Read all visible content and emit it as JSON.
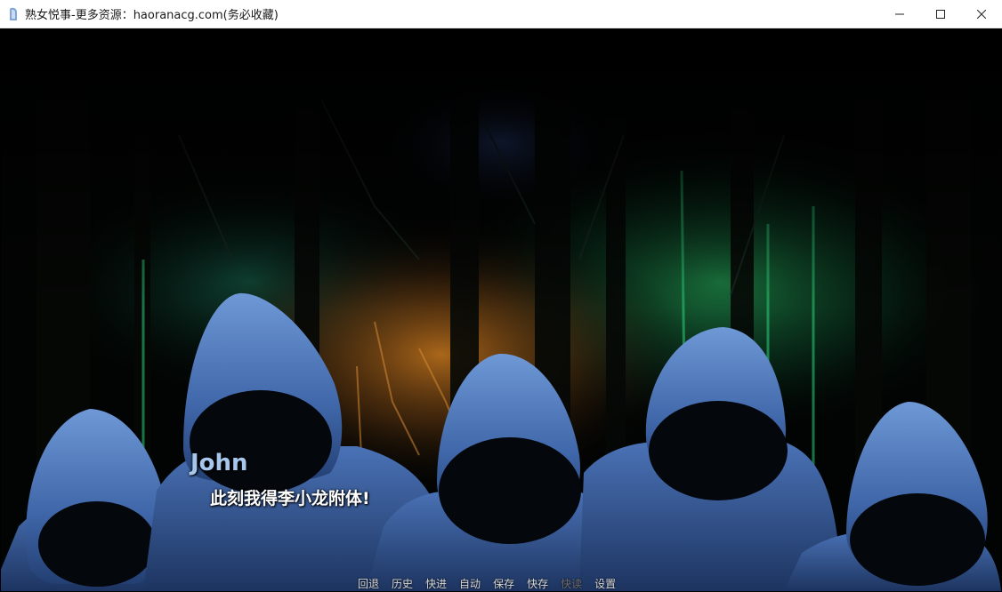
{
  "window": {
    "title": "熟女悦事-更多资源：haoranacg.com(务必收藏)",
    "controls": {
      "minimize": "minimize-icon",
      "maximize": "maximize-icon",
      "close": "close-icon"
    }
  },
  "dialogue": {
    "speaker": "John",
    "text": "此刻我得李小龙附体!"
  },
  "quick_menu": {
    "items": [
      {
        "label": "回退",
        "enabled": true
      },
      {
        "label": "历史",
        "enabled": true
      },
      {
        "label": "快进",
        "enabled": true
      },
      {
        "label": "自动",
        "enabled": true
      },
      {
        "label": "保存",
        "enabled": true
      },
      {
        "label": "快存",
        "enabled": true
      },
      {
        "label": "快读",
        "enabled": false
      },
      {
        "label": "设置",
        "enabled": true
      }
    ]
  },
  "colors": {
    "speaker_name": "#a7c6ec",
    "dialogue_text": "#ffffff",
    "menu_text": "#d8d8d8",
    "menu_disabled": "#6e6e6e"
  }
}
